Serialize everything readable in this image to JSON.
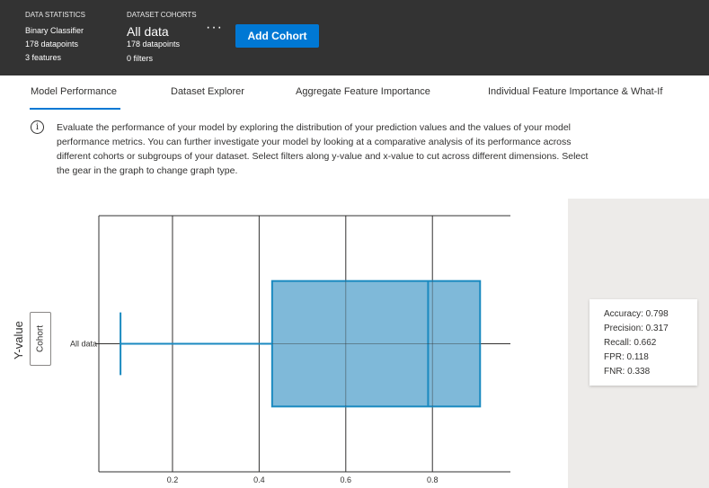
{
  "header": {
    "data_statistics_label": "DATA STATISTICS",
    "classifier": "Binary Classifier",
    "datapoints": "178 datapoints",
    "features": "3 features",
    "dataset_cohorts_label": "DATASET COHORTS",
    "cohort_name": "All data",
    "cohort_datapoints": "178 datapoints",
    "cohort_filters": "0 filters",
    "more_label": "···",
    "add_cohort_label": "Add Cohort"
  },
  "tabs": [
    {
      "label": "Model Performance",
      "active": true
    },
    {
      "label": "Dataset Explorer",
      "active": false
    },
    {
      "label": "Aggregate Feature Importance",
      "active": false
    },
    {
      "label": "Individual Feature Importance & What-If",
      "active": false
    }
  ],
  "info": {
    "icon": "info-icon",
    "glyph": "i",
    "text": "Evaluate the performance of your model by exploring the distribution of your prediction values and the values of your model performance metrics. You can further investigate your model by looking at a comparative analysis of its performance across different cohorts or subgroups of your dataset. Select filters along y-value and x-value to cut across different dimensions. Select the gear in the graph to change graph type."
  },
  "y_axis": {
    "title": "Y-value",
    "selector_label": "Cohort"
  },
  "metrics": [
    "Accuracy: 0.798",
    "Precision: 0.317",
    "Recall: 0.662",
    "FPR: 0.118",
    "FNR: 0.338"
  ],
  "colors": {
    "header_bg": "#333333",
    "accent": "#0078d4",
    "box_fill": "#7fb9d9",
    "box_stroke": "#1b8ac0",
    "panel_bg": "#edebe9"
  },
  "chart_data": {
    "type": "box",
    "orientation": "horizontal",
    "categories": [
      "All data"
    ],
    "boxes": [
      {
        "category": "All data",
        "min": 0.08,
        "q1": 0.43,
        "median": 0.79,
        "q3": 0.91,
        "max": 0.91
      }
    ],
    "xlim": [
      0.03,
      0.98
    ],
    "x_ticks": [
      0.2,
      0.4,
      0.6,
      0.8
    ],
    "x_tick_labels": [
      "0.2",
      "0.4",
      "0.6",
      "0.8"
    ],
    "grid": true
  }
}
